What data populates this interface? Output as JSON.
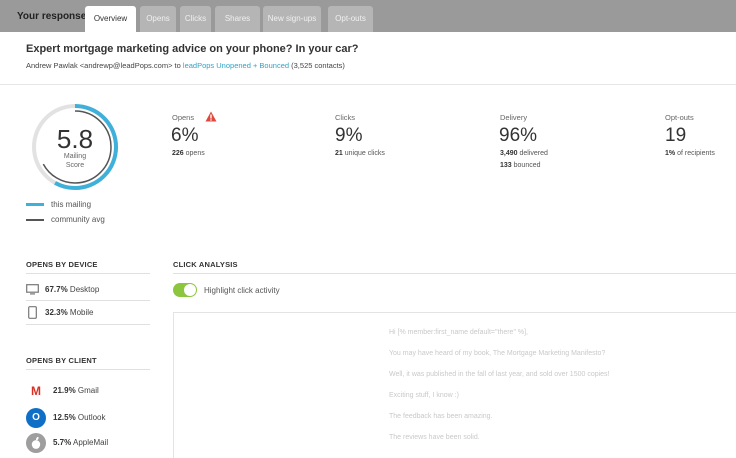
{
  "tabs": {
    "your_response": "Your response",
    "items": [
      "Overview",
      "Opens",
      "Clicks",
      "Shares",
      "New sign-ups",
      "Opt-outs"
    ],
    "active": "Overview"
  },
  "campaign": {
    "subject": "Expert mortgage marketing advice on your phone? In your car?",
    "sender": "Andrew Pawlak <andrewp@leadPops.com>",
    "to_word": "to",
    "list_link": "leadPops Unopened + Bounced",
    "contacts": "(3,525 contacts)"
  },
  "score": {
    "value": "5.8",
    "label_line1": "Mailing",
    "label_line2": "Score",
    "fraction": 0.58,
    "community_fraction": 0.67
  },
  "legend": {
    "this_mailing": "this mailing",
    "community_avg": "community avg"
  },
  "stats": {
    "opens": {
      "label": "Opens",
      "value": "6%",
      "sub_num": "226",
      "sub_text": "opens"
    },
    "clicks": {
      "label": "Clicks",
      "value": "9%",
      "sub_num": "21",
      "sub_text": "unique clicks"
    },
    "delivery": {
      "label": "Delivery",
      "value": "96%",
      "sub1_num": "3,490",
      "sub1_text": "delivered",
      "sub2_num": "133",
      "sub2_text": "bounced"
    },
    "optouts": {
      "label": "Opt-outs",
      "value": "19",
      "sub_num": "1%",
      "sub_text": "of recipients"
    }
  },
  "opens_by_device": {
    "title": "OPENS BY DEVICE",
    "items": [
      {
        "pct": "67.7%",
        "label": "Desktop",
        "icon": "desktop-icon"
      },
      {
        "pct": "32.3%",
        "label": "Mobile",
        "icon": "mobile-icon"
      }
    ]
  },
  "opens_by_client": {
    "title": "OPENS BY CLIENT",
    "items": [
      {
        "pct": "21.9%",
        "label": "Gmail",
        "icon": "gmail-icon",
        "glyph": "M"
      },
      {
        "pct": "12.5%",
        "label": "Outlook",
        "icon": "outlook-icon",
        "glyph": "O"
      },
      {
        "pct": "5.7%",
        "label": "AppleMail",
        "icon": "apple-icon",
        "glyph": ""
      }
    ]
  },
  "click_analysis": {
    "title": "CLICK ANALYSIS",
    "toggle_label": "Highlight click activity",
    "toggle_on": true,
    "preview_lines": [
      "Hi [% member:first_name default=\"there\" %],",
      "You may have heard of my book, The Mortgage Marketing Manifesto?",
      "Well, it was published in the fall of last year, and sold over 1500 copies!",
      "Exciting stuff, I know :)",
      "The feedback has been amazing.",
      "The reviews have been solid."
    ]
  },
  "colors": {
    "accent": "#2ea3c8",
    "score_ring": "#3fb0d9",
    "community_ring": "#555555",
    "toggle": "#8cc63f",
    "warning": "#e0483e",
    "tab_bar": "#9a9a9a"
  }
}
